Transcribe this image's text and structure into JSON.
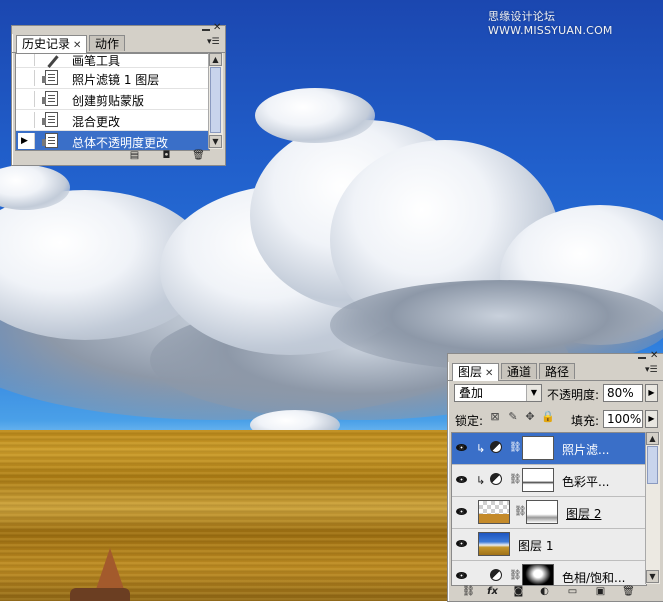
{
  "watermark": "思缘设计论坛  WWW.MISSYUAN.COM",
  "history_panel": {
    "tabs": [
      {
        "label": "历史记录",
        "active": true
      },
      {
        "label": "动作",
        "active": false
      }
    ],
    "items": [
      {
        "label": "画笔工具",
        "icon": "brush-icon",
        "selected": false
      },
      {
        "label": "照片滤镜 1 图层",
        "icon": "history-state-icon",
        "selected": false
      },
      {
        "label": "创建剪贴蒙版",
        "icon": "history-state-icon",
        "selected": false
      },
      {
        "label": "混合更改",
        "icon": "history-state-icon",
        "selected": false
      },
      {
        "label": "总体不透明度更改",
        "icon": "history-state-icon",
        "selected": true
      }
    ],
    "bottom_icons": [
      "new-document-icon",
      "snapshot-icon",
      "trash-icon"
    ]
  },
  "layers_panel": {
    "tabs": [
      {
        "label": "图层",
        "active": true
      },
      {
        "label": "通道",
        "active": false
      },
      {
        "label": "路径",
        "active": false
      }
    ],
    "blend_mode": "叠加",
    "opacity_label": "不透明度:",
    "opacity_value": "80%",
    "lock_label": "锁定:",
    "fill_label": "填充:",
    "fill_value": "100%",
    "layers": [
      {
        "name": "照片滤...",
        "type": "adjustment",
        "clipped": true,
        "selected": true
      },
      {
        "name": "色彩平...",
        "type": "adjustment",
        "clipped": true,
        "selected": false
      },
      {
        "name": "图层 2",
        "type": "pixel",
        "clipped": false,
        "selected": false
      },
      {
        "name": "图层 1",
        "type": "pixel",
        "clipped": false,
        "selected": false
      },
      {
        "name": "色相/饱和...",
        "type": "adjustment",
        "clipped": false,
        "selected": false
      }
    ],
    "bottom_icons": [
      "link-layers-icon",
      "fx-icon",
      "add-mask-icon",
      "adjustment-layer-icon",
      "group-folder-icon",
      "new-layer-icon",
      "trash-icon"
    ]
  },
  "colors": {
    "selection": "#3a6fc8",
    "panel_bg": "#d4d0c8",
    "sky": "#2160cc",
    "field": "#b8871a"
  }
}
